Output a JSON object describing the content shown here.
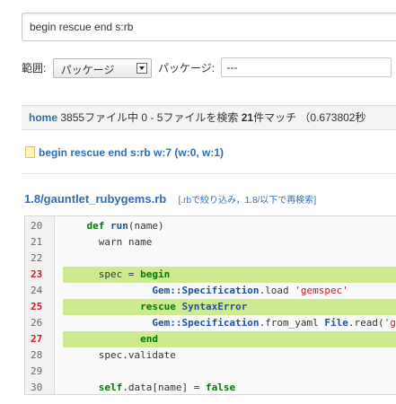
{
  "search": {
    "query": "begin rescue end s:rb"
  },
  "scope": {
    "label": "範囲:",
    "selected": "パッケージ",
    "package_label": "パッケージ:",
    "package_value": "---"
  },
  "results": {
    "home_link": "home",
    "text_before": " 3855ファイル中 0 - 5ファイルを検索 ",
    "match_count": "21",
    "text_after": "件マッチ （0.673802秒"
  },
  "query_link": {
    "text": "begin rescue end s:rb w:7 (w:0, w:1)"
  },
  "file": {
    "path": "1.8/gauntlet_rubygems.rb",
    "bracket_open": "[",
    "filter_link": ".rbで絞り込み",
    "separator": "，",
    "search_link": "1.8/以下で再検索",
    "bracket_close": "]"
  },
  "code_lines": [
    {
      "num": "20",
      "hl": false,
      "parts": [
        [
          "",
          "    "
        ],
        [
          "kw",
          "def"
        ],
        [
          "",
          " "
        ],
        [
          "fn",
          "run"
        ],
        [
          "",
          "(name)"
        ]
      ]
    },
    {
      "num": "21",
      "hl": false,
      "parts": [
        [
          "",
          "      warn name"
        ]
      ]
    },
    {
      "num": "22",
      "hl": false,
      "parts": [
        [
          "",
          ""
        ]
      ]
    },
    {
      "num": "23",
      "hl": true,
      "parts": [
        [
          "",
          "      spec = "
        ],
        [
          "kw",
          "begin"
        ]
      ]
    },
    {
      "num": "24",
      "hl": false,
      "parts": [
        [
          "",
          "               "
        ],
        [
          "const",
          "Gem::Specification"
        ],
        [
          "",
          ".load "
        ],
        [
          "str",
          "'gemspec'"
        ]
      ]
    },
    {
      "num": "25",
      "hl": true,
      "parts": [
        [
          "",
          "             "
        ],
        [
          "kw",
          "rescue"
        ],
        [
          "",
          " "
        ],
        [
          "const",
          "SyntaxError"
        ]
      ]
    },
    {
      "num": "26",
      "hl": false,
      "parts": [
        [
          "",
          "               "
        ],
        [
          "const",
          "Gem::Specification"
        ],
        [
          "",
          ".from_yaml "
        ],
        [
          "const",
          "File"
        ],
        [
          "",
          ".read("
        ],
        [
          "str",
          "'gemspec'"
        ],
        [
          "",
          ")"
        ]
      ]
    },
    {
      "num": "27",
      "hl": true,
      "parts": [
        [
          "",
          "             "
        ],
        [
          "kw",
          "end"
        ]
      ]
    },
    {
      "num": "28",
      "hl": false,
      "parts": [
        [
          "",
          "      spec.validate"
        ]
      ]
    },
    {
      "num": "29",
      "hl": false,
      "parts": [
        [
          "",
          ""
        ]
      ]
    },
    {
      "num": "30",
      "hl": false,
      "parts": [
        [
          "",
          "      "
        ],
        [
          "kw",
          "self"
        ],
        [
          "",
          ".data[name] = "
        ],
        [
          "kw",
          "false"
        ]
      ]
    }
  ],
  "colors": {
    "link": "#2f6db5",
    "highlight": "#cdea90",
    "keyword": "#007a00",
    "string": "#c41a16",
    "constant": "#1f4fa0",
    "match_line_number": "#cc1b1b"
  }
}
